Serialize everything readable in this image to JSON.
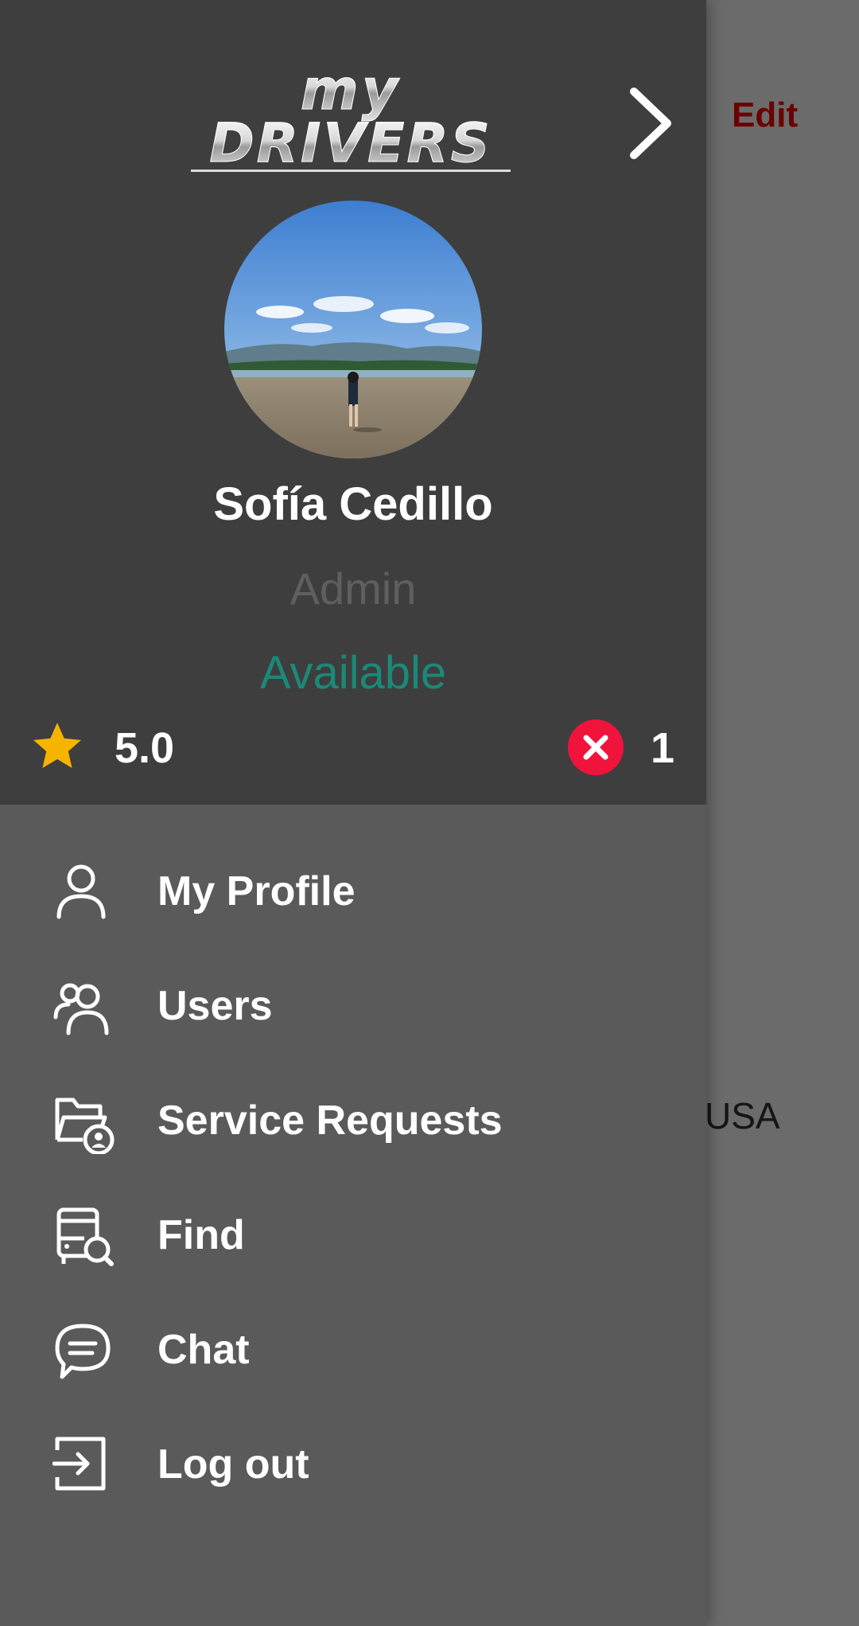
{
  "background": {
    "edit_label": "Edit",
    "country_text": "USA"
  },
  "drawer": {
    "logo_text_line1": "my",
    "logo_text_line2": "DRIVERS",
    "user": {
      "name": "Sofía Cedillo",
      "role": "Admin",
      "status": "Available"
    },
    "stats": {
      "rating": "5.0",
      "cancellations": "1"
    },
    "menu": [
      {
        "label": "My Profile",
        "icon": "user-icon"
      },
      {
        "label": "Users",
        "icon": "users-icon"
      },
      {
        "label": "Service Requests",
        "icon": "folder-user-icon"
      },
      {
        "label": "Find",
        "icon": "bus-search-icon"
      },
      {
        "label": "Chat",
        "icon": "chat-icon"
      },
      {
        "label": "Log out",
        "icon": "logout-icon"
      }
    ]
  },
  "colors": {
    "header_bg": "#3e3e3e",
    "menu_bg": "#5a5a5a",
    "status_available": "#1a8a78",
    "star": "#f4b400",
    "cancel_badge": "#f0143c",
    "edit_text": "#6b0000"
  }
}
